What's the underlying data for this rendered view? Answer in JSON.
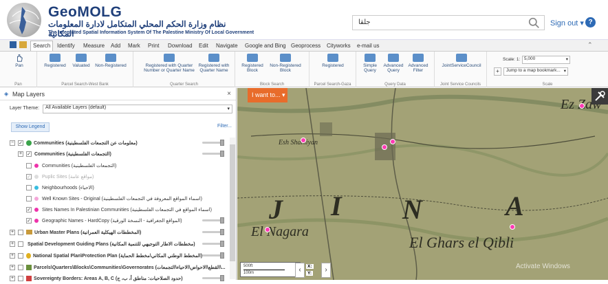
{
  "header": {
    "title": "GeoMOLG",
    "subtitle_ar": "نظام وزارة الحكم المحلي المتكامل لادارة المعلومات المكانية",
    "subtitle_en": "The Integrated Spatial Information System Of The Palestine Ministry Of Local Government",
    "search_value": "جلقا",
    "signout_label": "Sign out",
    "help_label": "?"
  },
  "menu": {
    "tabs": [
      "Search",
      "Identify",
      "Measure",
      "Add",
      "Mark",
      "Print",
      "Download",
      "Edit",
      "Navigate",
      "Google and Bing",
      "Geoprocess",
      "Cityworks",
      "e-mail us"
    ],
    "active": "Search"
  },
  "ribbon": {
    "pan": {
      "label": "Pan",
      "group": "Pan"
    },
    "parcel_wb": {
      "buttons": [
        "Registered",
        "Valuated",
        "Non-Registered"
      ],
      "group": "Parcel Search-West Bank"
    },
    "quarter": {
      "buttons": [
        "Registered with Quarter Number or Quarter Name",
        "Registered with Quarter Name"
      ],
      "group": "Quarter Search"
    },
    "block": {
      "buttons": [
        "Registered Block",
        "Non-Registered Block"
      ],
      "group": "Block Search"
    },
    "gaza": {
      "buttons": [
        "Registered"
      ],
      "group": "Parcel Search-Gaza"
    },
    "query": {
      "buttons": [
        "Simple Query",
        "Advanced Query",
        "Advanced Filter"
      ],
      "group": "Query Data"
    },
    "jsc": {
      "buttons": [
        "JointServiceCouncil"
      ],
      "group": "Joint Service Councils"
    },
    "scale": {
      "label": "Scale: 1:",
      "value": "5,000",
      "bookmark": "Jump to a map bookmark...",
      "plus": "+",
      "group": "Scale"
    }
  },
  "layers": {
    "panel_title": "Map Layers",
    "close": "×",
    "theme_label": "Layer Theme:",
    "theme_value": "All Available Layers (default)",
    "show_legend": "Show Legend",
    "filter": "Filter...",
    "rows": [
      {
        "label": "Communities (معلومات عن التجمعات الفلسطينية)",
        "expander": "−",
        "checked": "✓"
      },
      {
        "label": "Communities (التجمعات الفلسطينية)",
        "expander": "+",
        "checked": "✓"
      },
      {
        "label": "Communities (التجمعات الفلسطينية)",
        "checked": "",
        "color": "#ee33aa"
      },
      {
        "label": "Puplic Sites (مواقع عامة)",
        "checked": "✓",
        "color": "#cccccc"
      },
      {
        "label": "Neighbourhoods (الاحياء)",
        "checked": "",
        "color": "#38bde0"
      },
      {
        "label": "Well Known Sites - Original (اسماء المواقع المعروفة في التجمعات الفلسطينية)",
        "checked": "",
        "color": "#f4a7d9"
      },
      {
        "label": "Sites Names In Palestinian Communities (اسماء المواقع في التجمعات الفلسطينية)",
        "checked": "✓",
        "color": "#ee33aa"
      },
      {
        "label": "Geographic Names - HardCopy (المواقع الجغرافية - النسخة الورقية)",
        "checked": "✓",
        "color": "#ee33aa"
      },
      {
        "label": "Urban Master Plans (المخططات الهيكلية العمرانية)",
        "expander": "+",
        "checked": ""
      },
      {
        "label": "Spatial Development Guiding Plans (مخططات الاطار التوجيهي للتنمية المكانية)",
        "expander": "+",
        "checked": ""
      },
      {
        "label": "National Spatial Plan\\Protection Plan (المخطط الوطني المكاني\\مخطط الحماية)",
        "expander": "+",
        "checked": ""
      },
      {
        "label": "Parcels\\Quarters\\Blocks\\Communities\\Governorates (القطع\\الاحواض\\الاحياء\\التجمعات\\...",
        "expander": "+",
        "checked": ""
      },
      {
        "label": "Sovereignty Borders: Areas A, B, C (حدود الصلاحيات: مناطق أ، ب، ج)",
        "expander": "+",
        "checked": ""
      }
    ]
  },
  "map": {
    "iwant": "I want to...",
    "scale_ft": "500ft",
    "scale_m": "100m",
    "x_label": "X:",
    "y_label": "Y:",
    "watermark": "Activate Windows",
    "labels": [
      "J",
      "I",
      "N",
      "A",
      "El Ghars el Qibli",
      "El Nagara",
      "Esh Shamiyan",
      "Ez Zaw"
    ]
  }
}
